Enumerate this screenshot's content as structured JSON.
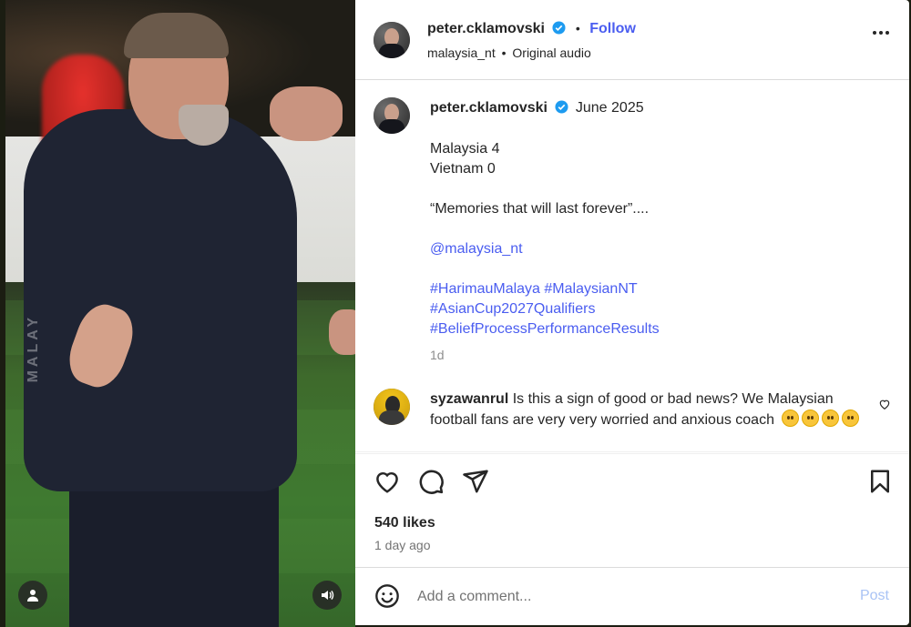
{
  "video": {
    "watermark": "MALAY",
    "icons": {
      "profile": "person-icon",
      "sound": "speaker-icon"
    }
  },
  "header": {
    "username": "peter.cklamovski",
    "follow": "Follow",
    "separator": "•",
    "subtitle_account": "malaysia_nt",
    "subtitle_audio": "Original audio"
  },
  "caption": {
    "username": "peter.cklamovski",
    "date": "June 2025",
    "lines": [
      "Malaysia 4",
      "Vietnam 0",
      "",
      "“Memories that will last forever”....",
      "",
      "@malaysia_nt",
      "",
      "#HarimauMalaya #MalaysianNT",
      "#AsianCup2027Qualifiers",
      "#BeliefProcessPerformanceResults"
    ],
    "age": "1d"
  },
  "comment": {
    "username": "syzawanrul",
    "text": "Is this a sign of good or bad news? We Malaysian football fans are very very worried and anxious coach"
  },
  "actions": {
    "likes": "540 likes",
    "time": "1 day ago"
  },
  "add_comment": {
    "placeholder": "Add a comment...",
    "post": "Post"
  },
  "colors": {
    "accent": "#4a5df0",
    "post_disabled": "#a9c3f5",
    "verified": "#1d9bf0"
  }
}
